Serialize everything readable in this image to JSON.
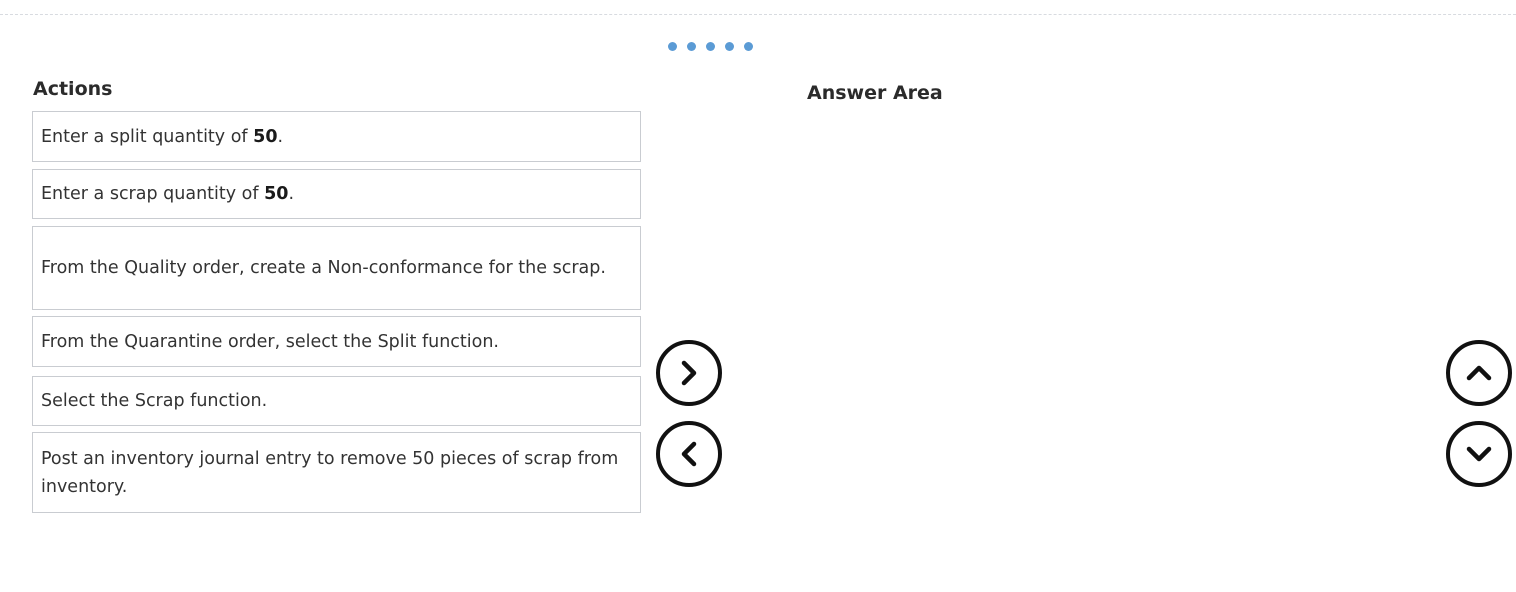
{
  "carousel": {
    "dot_count": 5,
    "dot_color": "#5b9bd5"
  },
  "actions": {
    "title": "Actions",
    "items": [
      {
        "text": "Enter a split quantity of ",
        "bold": "50",
        "tail": "."
      },
      {
        "text": "Enter a scrap quantity of ",
        "bold": "50",
        "tail": "."
      },
      {
        "text": "From the Quality order, create a Non-conformance for the scrap.",
        "bold": "",
        "tail": ""
      },
      {
        "text": "From the Quarantine order, select the Split function.",
        "bold": "",
        "tail": ""
      },
      {
        "text": "Select the Scrap function.",
        "bold": "",
        "tail": ""
      },
      {
        "text": "Post an inventory journal entry to remove 50 pieces of scrap from inventory.",
        "bold": "",
        "tail": ""
      }
    ]
  },
  "answer_area": {
    "title": "Answer Area",
    "items": []
  },
  "controls": {
    "move_right_icon": "chevron-right-icon",
    "move_left_icon": "chevron-left-icon",
    "move_up_icon": "chevron-up-icon",
    "move_down_icon": "chevron-down-icon"
  }
}
